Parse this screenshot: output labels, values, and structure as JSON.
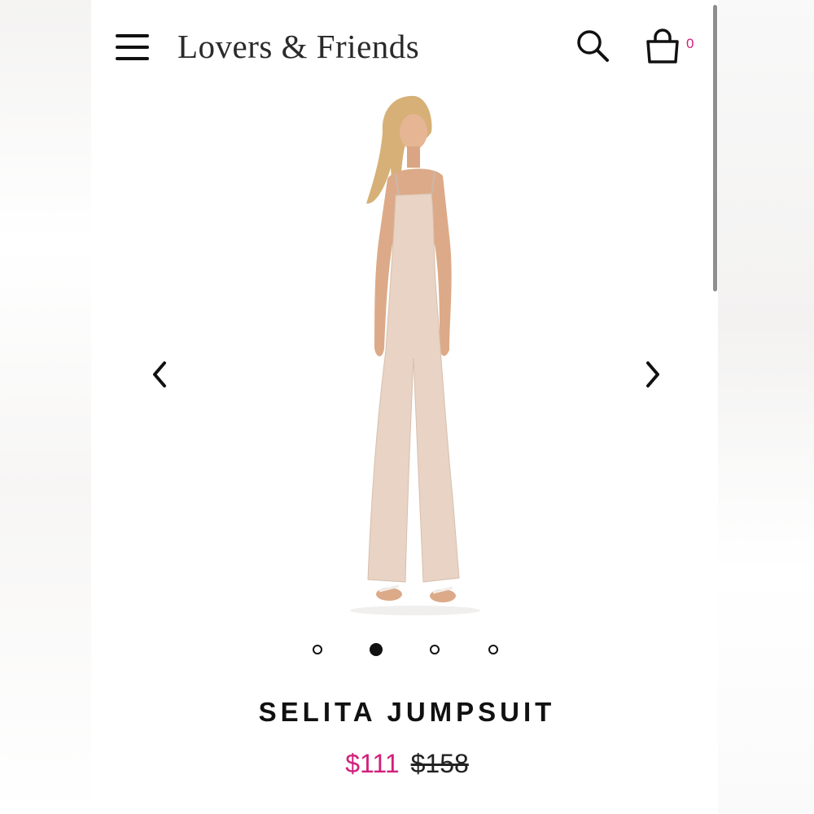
{
  "header": {
    "brand": "Lovers & Friends",
    "cart_count": "0",
    "icons": {
      "menu": "hamburger-menu-icon",
      "search": "search-icon",
      "cart": "shopping-bag-icon"
    }
  },
  "carousel": {
    "image_alt": "Model wearing Selita Jumpsuit",
    "slide_count": 4,
    "active_slide": 2,
    "icons": {
      "prev": "chevron-left-icon",
      "next": "chevron-right-icon"
    }
  },
  "product": {
    "name": "SELITA JUMPSUIT",
    "sale_price": "$111",
    "original_price": "$158"
  },
  "colors": {
    "accent": "#d21f7b",
    "text": "#111111",
    "fabric": "#e8d3c4"
  }
}
